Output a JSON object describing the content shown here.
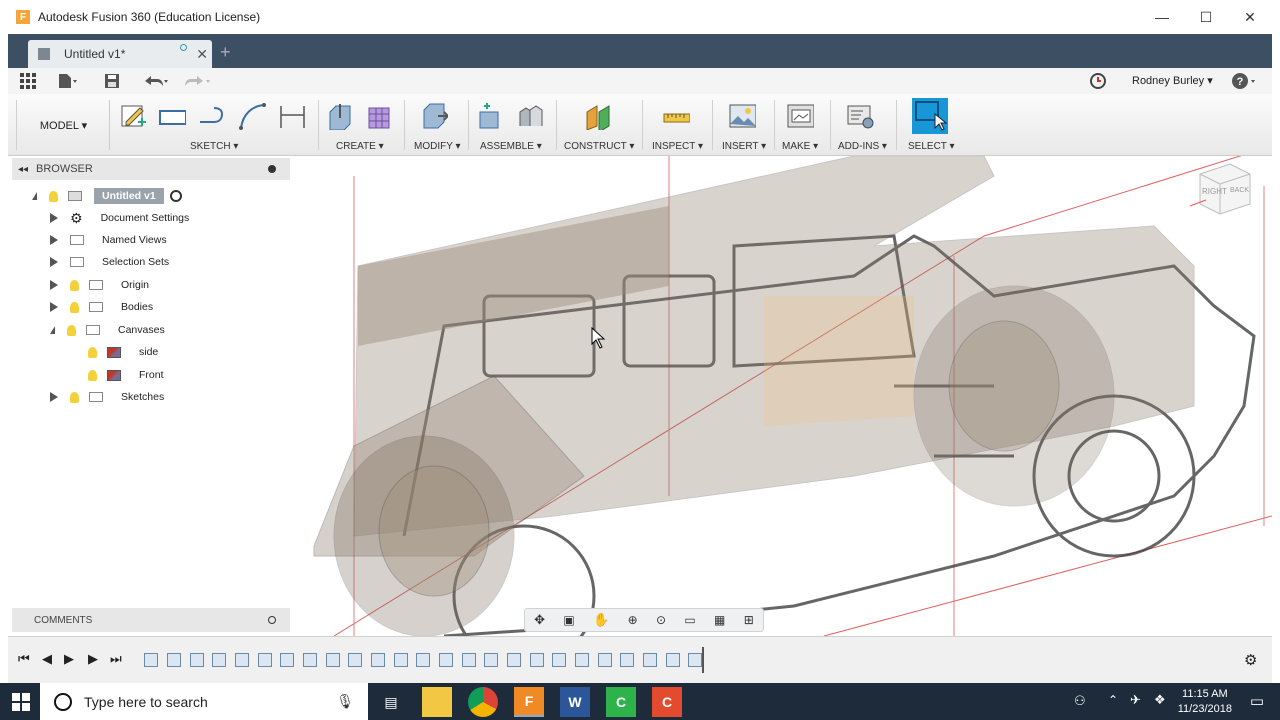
{
  "window": {
    "title": "Autodesk Fusion 360 (Education License)",
    "minimize": "—",
    "maximize": "☐",
    "close": "✕"
  },
  "tabs": {
    "doc_tab_label": "Untitled v1*",
    "new_tab": "+"
  },
  "quickaccess": {
    "user_name": "Rodney Burley ▾",
    "help": "?"
  },
  "toolbar": {
    "workspace": "MODEL ▾",
    "groups": [
      "SKETCH ▾",
      "CREATE ▾",
      "MODIFY ▾",
      "ASSEMBLE ▾",
      "CONSTRUCT ▾",
      "INSPECT ▾",
      "INSERT ▾",
      "MAKE ▾",
      "ADD-INS ▾",
      "SELECT ▾"
    ]
  },
  "browser": {
    "title": "BROWSER",
    "root": "Untitled v1",
    "items": [
      "Document Settings",
      "Named Views",
      "Selection Sets",
      "Origin",
      "Bodies",
      "Canvases",
      "side",
      "Front",
      "Sketches"
    ]
  },
  "comments": {
    "title": "COMMENTS"
  },
  "viewcube": {
    "right": "RIGHT",
    "back": "BACK"
  },
  "taskbar": {
    "search_placeholder": "Type here to search",
    "time": "11:15 AM",
    "date": "11/23/2018"
  },
  "colors": {
    "tabbar": "#3d4f63",
    "select_button": "#1796d8",
    "taskbar": "#1d2b3b"
  }
}
